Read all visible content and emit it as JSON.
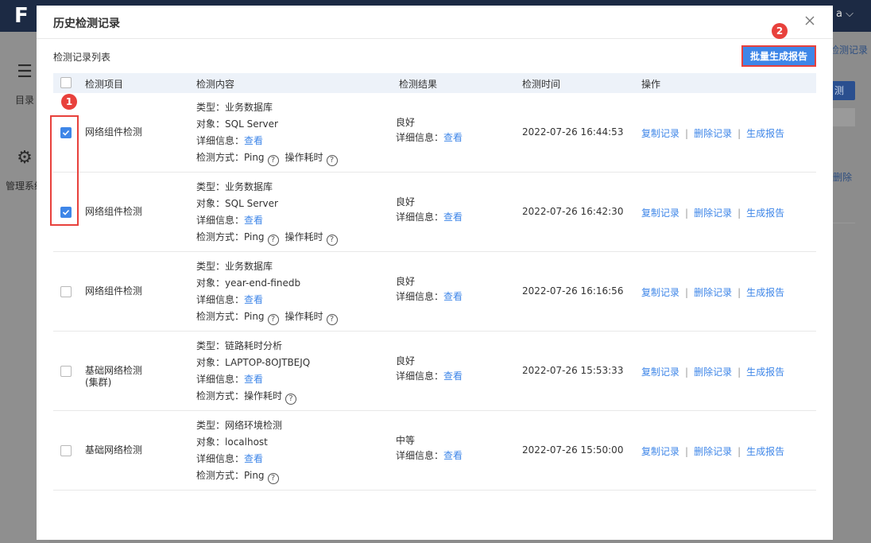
{
  "background": {
    "user_suffix": "a",
    "sidebar": [
      {
        "label": "目录",
        "icon": "list-icon"
      },
      {
        "label": "管理系统",
        "icon": "gear-icon"
      }
    ],
    "right_link": "检测记录",
    "right_btn": "测",
    "right_delete": "删除"
  },
  "modal": {
    "title": "历史检测记录",
    "list_title": "检测记录列表",
    "batch_button": "批量生成报告",
    "callouts": [
      "1",
      "2"
    ],
    "columns": [
      "检测项目",
      "检测内容",
      "检测结果",
      "检测时间",
      "操作"
    ],
    "labels": {
      "type": "类型：",
      "object": "对象：",
      "detail": "详细信息：",
      "view": "查看",
      "method": "检测方式：",
      "ping": "Ping",
      "op_time": "操作耗时",
      "help": "?"
    },
    "actions": {
      "copy": "复制记录",
      "delete": "删除记录",
      "report": "生成报告",
      "sep": "|"
    },
    "rows": [
      {
        "checked": true,
        "item": "网络组件检测",
        "item2": "",
        "type": "业务数据库",
        "object": "SQL Server",
        "method": "ping_op",
        "result": "良好",
        "time": "2022-07-26 16:44:53"
      },
      {
        "checked": true,
        "item": "网络组件检测",
        "item2": "",
        "type": "业务数据库",
        "object": "SQL Server",
        "method": "ping_op",
        "result": "良好",
        "time": "2022-07-26 16:42:30"
      },
      {
        "checked": false,
        "item": "网络组件检测",
        "item2": "",
        "type": "业务数据库",
        "object": "year-end-finedb",
        "method": "ping_op",
        "result": "良好",
        "time": "2022-07-26 16:16:56"
      },
      {
        "checked": false,
        "item": "基础网络检测",
        "item2": "(集群)",
        "type": "链路耗时分析",
        "object": "LAPTOP-8OJTBEJQ",
        "method": "op",
        "result": "良好",
        "time": "2022-07-26 15:53:33"
      },
      {
        "checked": false,
        "item": "基础网络检测",
        "item2": "",
        "type": "网络环境检测",
        "object": "localhost",
        "method": "ping",
        "result": "中等",
        "time": "2022-07-26 15:50:00"
      }
    ]
  },
  "colors": {
    "accent": "#3e86e8",
    "callout": "#e8413c",
    "header_bg": "#edf2f9",
    "topbar": "#1c2a44"
  }
}
